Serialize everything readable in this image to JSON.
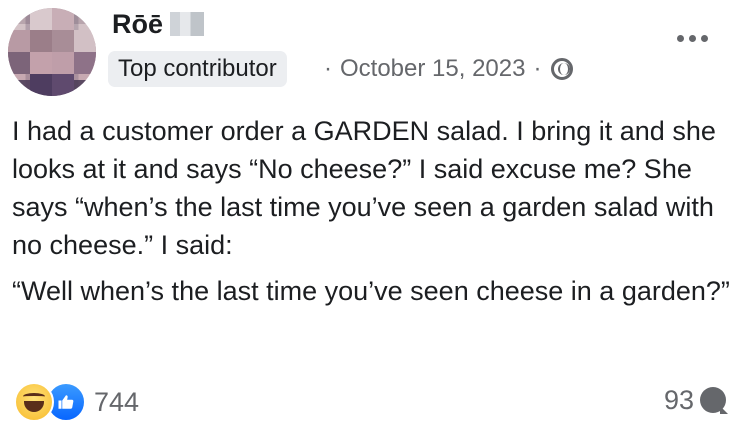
{
  "post": {
    "author": {
      "name": "Rōē",
      "badge": "Top contributor"
    },
    "meta": {
      "separator": "·",
      "date": "October 15, 2023",
      "audience_icon": "globe-icon"
    },
    "paragraphs": [
      "I had a customer order a GARDEN salad. I bring it and she looks at it and says “No cheese?” I said excuse me? She says “when’s the last time you’ve seen a garden salad with no cheese.” I said:",
      "“Well when’s the last time you’ve seen cheese in a garden?”"
    ],
    "reactions": {
      "icons": [
        "haha-icon",
        "like-icon"
      ],
      "count": "744"
    },
    "comments": {
      "count": "93",
      "icon": "comment-icon"
    },
    "colors": {
      "text": "#1c1e21",
      "secondary": "#65676b",
      "like_blue": "#0866ff",
      "haha_yellow": "#f7b928",
      "badge_bg": "#eceef1"
    }
  }
}
